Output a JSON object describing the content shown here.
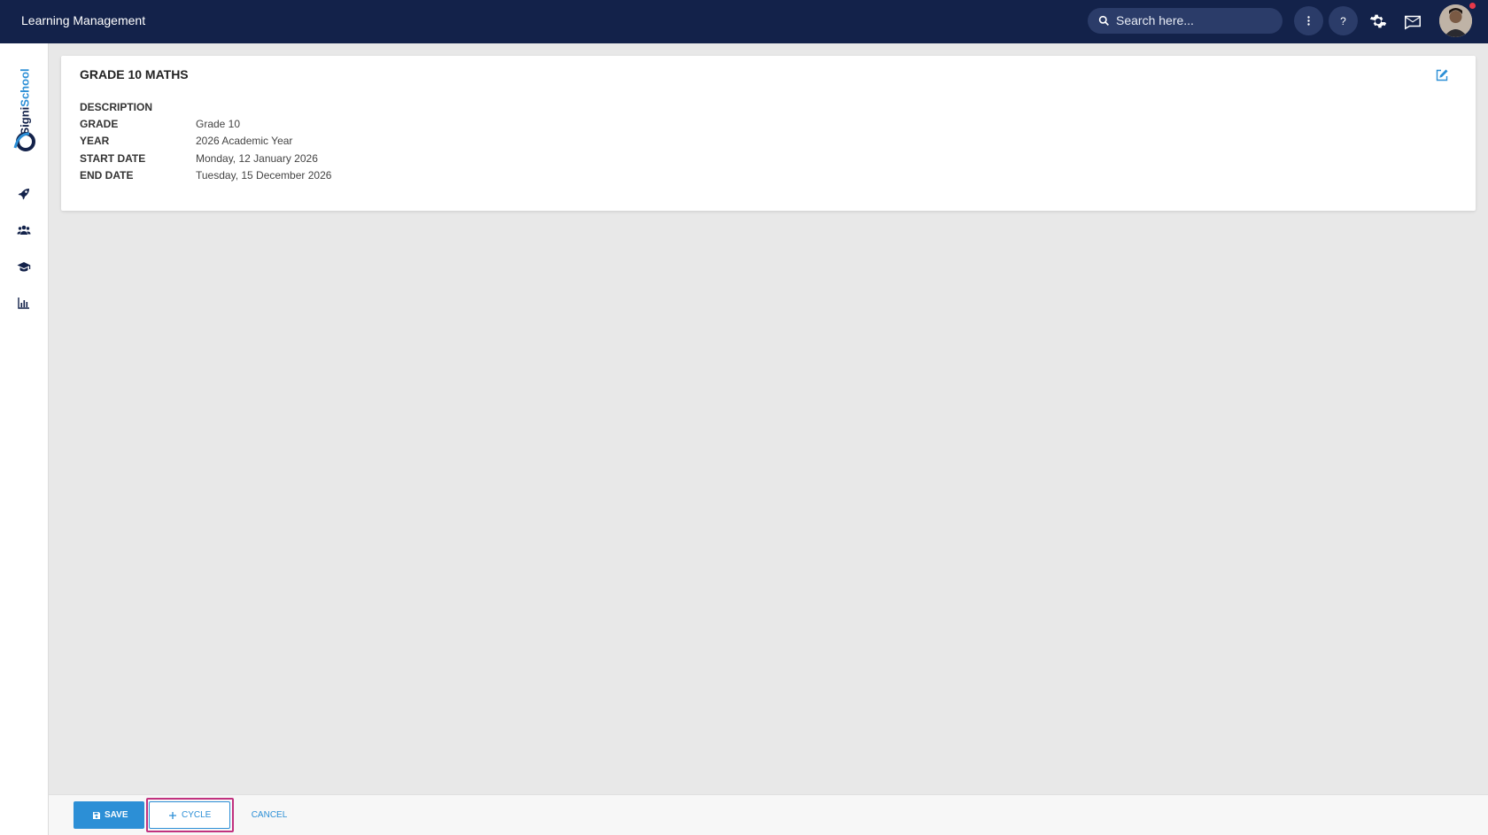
{
  "app": {
    "title": "Learning Management"
  },
  "search": {
    "placeholder": "Search here..."
  },
  "header_icons": [
    "more-vertical-icon",
    "help-icon",
    "settings-icon",
    "messages-icon",
    "user-avatar"
  ],
  "sidebar": {
    "logo": {
      "part1": "Signi",
      "part2": "School"
    },
    "items": [
      {
        "name": "rocket-icon"
      },
      {
        "name": "people-icon"
      },
      {
        "name": "graduation-cap-icon"
      },
      {
        "name": "bar-chart-icon"
      }
    ]
  },
  "course": {
    "title": "GRADE 10 MATHS",
    "details": [
      {
        "label": "DESCRIPTION",
        "value": ""
      },
      {
        "label": "GRADE",
        "value": "Grade 10"
      },
      {
        "label": "YEAR",
        "value": "2026 Academic Year"
      },
      {
        "label": "START DATE",
        "value": "Monday, 12 January 2026"
      },
      {
        "label": "END DATE",
        "value": "Tuesday, 15 December 2026"
      }
    ]
  },
  "actions": {
    "save": "SAVE",
    "cycle": "CYCLE",
    "cancel": "CANCEL"
  },
  "colors": {
    "header": "#13224a",
    "accent": "#2c8fd6",
    "highlight": "#c1317f",
    "background": "#e8e8e8"
  }
}
